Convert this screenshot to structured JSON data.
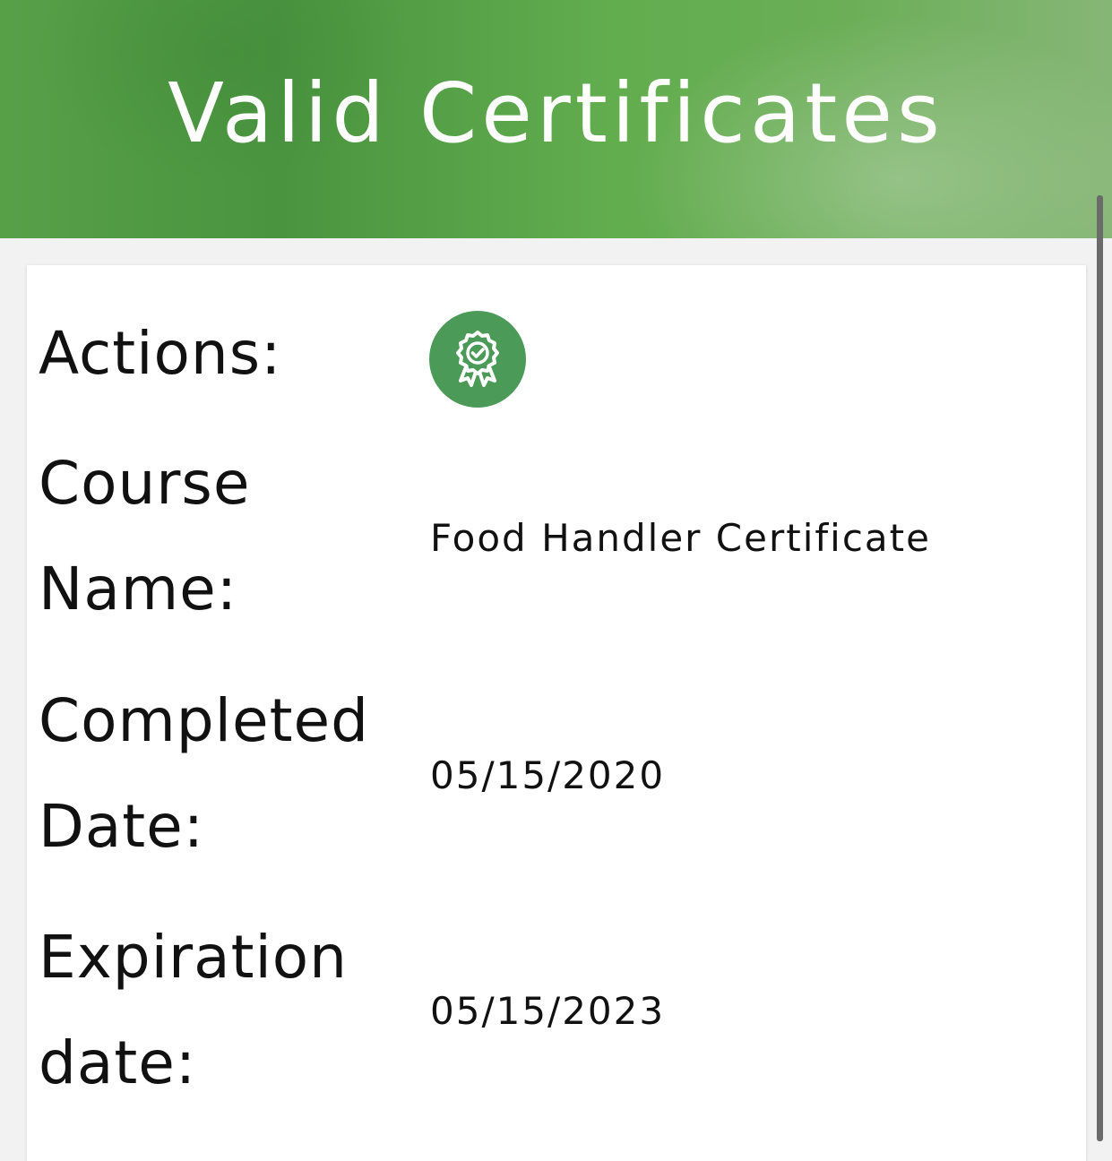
{
  "header": {
    "title": "Valid Certificates"
  },
  "certificate": {
    "actions_label": "Actions:",
    "course_name_label_line1": "Course",
    "course_name_label_line2": "Name:",
    "course_name_value": "Food Handler Certificate",
    "completed_label_line1": "Completed",
    "completed_label_line2": "Date:",
    "completed_value": "05/15/2020",
    "expiration_label_line1": "Expiration",
    "expiration_label_line2": "date:",
    "expiration_value": "05/15/2023",
    "action_icon": "certificate-award-icon"
  },
  "colors": {
    "header_green": "#58a048",
    "action_button": "#4b9a58",
    "text": "#111111"
  }
}
